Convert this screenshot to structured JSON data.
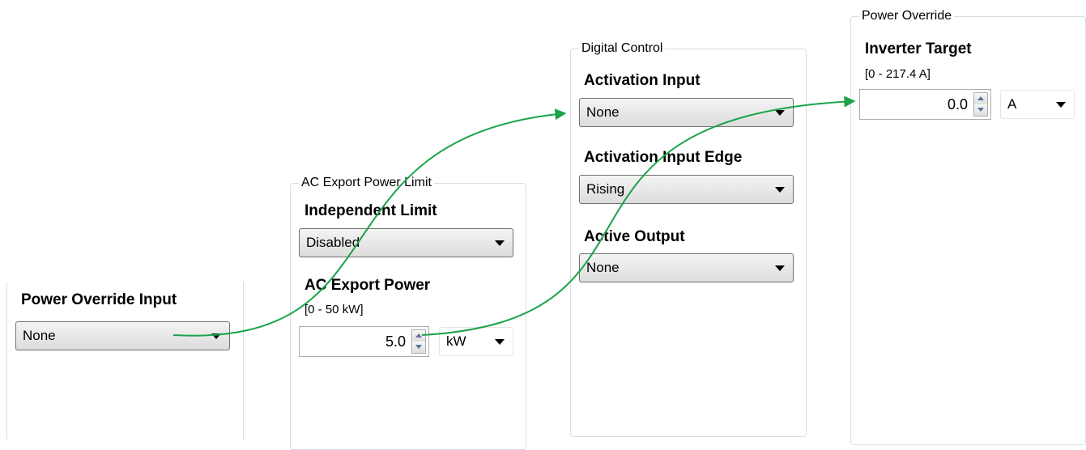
{
  "panels": {
    "left": {
      "power_override_input": {
        "label": "Power Override Input",
        "value": "None"
      }
    },
    "ac_export": {
      "title": "AC Export Power Limit",
      "independent_limit": {
        "label": "Independent Limit",
        "value": "Disabled"
      },
      "ac_export_power": {
        "label": "AC Export Power",
        "range": "[0 - 50 kW]",
        "value": "5.0",
        "unit": "kW"
      }
    },
    "digital_control": {
      "title": "Digital Control",
      "activation_input": {
        "label": "Activation Input",
        "value": "None"
      },
      "activation_input_edge": {
        "label": "Activation Input Edge",
        "value": "Rising"
      },
      "active_output": {
        "label": "Active Output",
        "value": "None"
      }
    },
    "power_override": {
      "title": "Power Override",
      "inverter_target": {
        "label": "Inverter Target",
        "range": "[0 - 217.4 A]",
        "value": "0.0",
        "unit": "A"
      }
    }
  },
  "icons": {
    "dropdown": "chevron-down-icon",
    "spinner_up": "spin-up-icon",
    "spinner_down": "spin-down-icon"
  },
  "annotations": {
    "arrow_color": "#1aa34a",
    "arrows": [
      {
        "from": "power-override-input-select",
        "to": "activation-input-select"
      },
      {
        "from": "ac-export-power-input",
        "to": "inverter-target-input"
      }
    ]
  }
}
